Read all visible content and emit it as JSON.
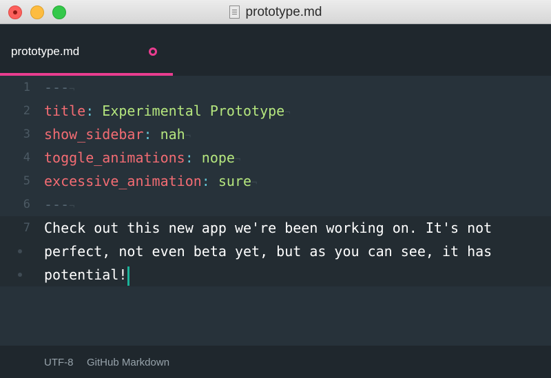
{
  "window": {
    "title": "prototype.md"
  },
  "tab": {
    "label": "prototype.md",
    "accent_color": "#e93d8f",
    "modified_indicator": "circle-icon"
  },
  "editor": {
    "lines": [
      {
        "number": "1",
        "key": "",
        "sep": "",
        "value": "",
        "dashes": "---"
      },
      {
        "number": "2",
        "key": "title",
        "sep": ":",
        "value": " Experimental Prototype"
      },
      {
        "number": "3",
        "key": "show_sidebar",
        "sep": ":",
        "value": " nah"
      },
      {
        "number": "4",
        "key": "toggle_animations",
        "sep": ":",
        "value": " nope"
      },
      {
        "number": "5",
        "key": "excessive_animation",
        "sep": ":",
        "value": " sure"
      },
      {
        "number": "6",
        "key": "",
        "sep": "",
        "value": "",
        "dashes": "---"
      },
      {
        "number": "7",
        "text": "Check out this new app we're been working on. It's not"
      },
      {
        "number": "",
        "text": "perfect, not even beta yet, but as you can see, it has"
      },
      {
        "number": "",
        "text": "potential!"
      }
    ],
    "eol_marker": "¬",
    "cursor_color": "#1bb39a"
  },
  "status": {
    "encoding": "UTF-8",
    "syntax": "GitHub Markdown"
  }
}
